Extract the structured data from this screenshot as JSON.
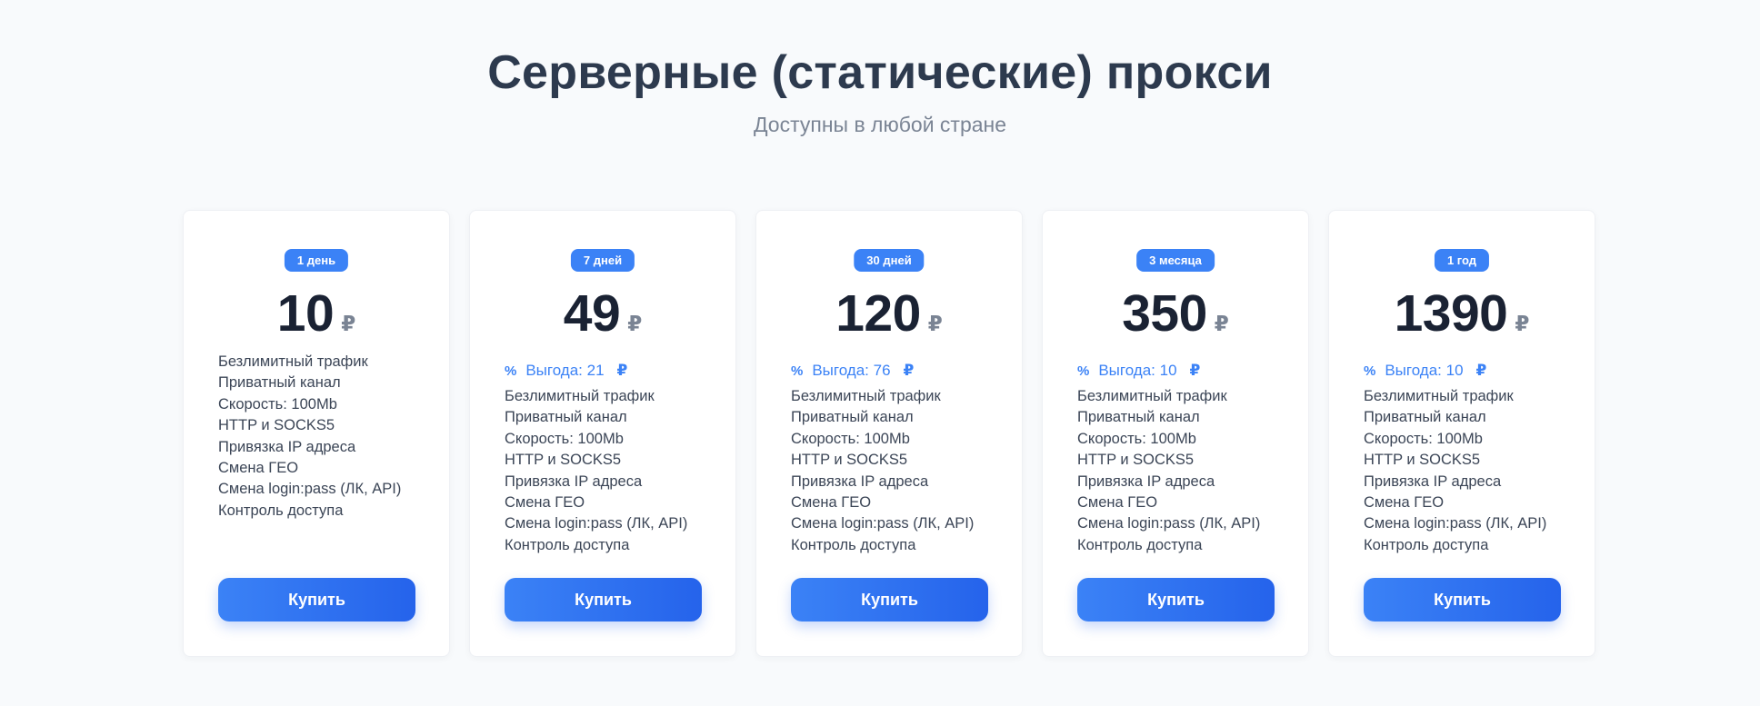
{
  "header": {
    "title": "Серверные (статические) прокси",
    "subtitle": "Доступны в любой стране"
  },
  "currency_symbol": "₽",
  "benefit_icon": "percent-icon",
  "colors": {
    "accent": "#3b82f6",
    "title": "#2d3a4e",
    "background": "#f8fafc"
  },
  "plans": [
    {
      "period": "1 день",
      "price": "10",
      "benefit": null,
      "features": [
        "Безлимитный трафик",
        "Приватный канал",
        "Скорость: 100Mb",
        "HTTP и SOCKS5",
        "Привязка IP адреса",
        "Смена ГЕО",
        "Смена login:pass (ЛК, API)",
        "Контроль доступа"
      ],
      "button": "Купить"
    },
    {
      "period": "7 дней",
      "price": "49",
      "benefit": "Выгода: 21",
      "features": [
        "Безлимитный трафик",
        "Приватный канал",
        "Скорость: 100Mb",
        "HTTP и SOCKS5",
        "Привязка IP адреса",
        "Смена ГЕО",
        "Смена login:pass (ЛК, API)",
        "Контроль доступа"
      ],
      "button": "Купить"
    },
    {
      "period": "30 дней",
      "price": "120",
      "benefit": "Выгода: 76",
      "features": [
        "Безлимитный трафик",
        "Приватный канал",
        "Скорость: 100Mb",
        "HTTP и SOCKS5",
        "Привязка IP адреса",
        "Смена ГЕО",
        "Смена login:pass (ЛК, API)",
        "Контроль доступа"
      ],
      "button": "Купить"
    },
    {
      "period": "3 месяца",
      "price": "350",
      "benefit": "Выгода: 10",
      "features": [
        "Безлимитный трафик",
        "Приватный канал",
        "Скорость: 100Mb",
        "HTTP и SOCKS5",
        "Привязка IP адреса",
        "Смена ГЕО",
        "Смена login:pass (ЛК, API)",
        "Контроль доступа"
      ],
      "button": "Купить"
    },
    {
      "period": "1 год",
      "price": "1390",
      "benefit": "Выгода: 10",
      "features": [
        "Безлимитный трафик",
        "Приватный канал",
        "Скорость: 100Mb",
        "HTTP и SOCKS5",
        "Привязка IP адреса",
        "Смена ГЕО",
        "Смена login:pass (ЛК, API)",
        "Контроль доступа"
      ],
      "button": "Купить"
    }
  ]
}
